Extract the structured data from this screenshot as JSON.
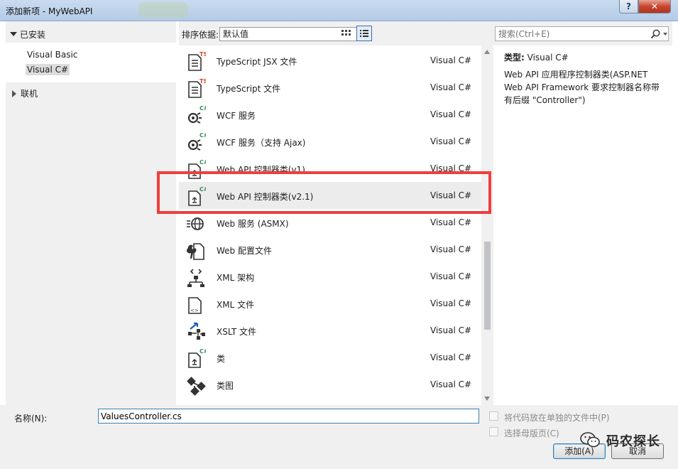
{
  "window": {
    "title": "添加新项 - MyWebAPI",
    "help_label": "?",
    "close_label": "✕"
  },
  "left_tree": {
    "installed": "已安装",
    "children": [
      "Visual Basic",
      "Visual C#"
    ],
    "selected": "Visual C#",
    "online": "联机"
  },
  "toolbar": {
    "sort_label": "排序依据:",
    "sort_value": "默认值"
  },
  "items": [
    {
      "name": "TypeScript JSX 文件",
      "type": "Visual C#",
      "icon": "typescript-file-icon"
    },
    {
      "name": "TypeScript 文件",
      "type": "Visual C#",
      "icon": "typescript-file-icon"
    },
    {
      "name": "WCF 服务",
      "type": "Visual C#",
      "icon": "wcf-service-icon"
    },
    {
      "name": "WCF 服务（支持 Ajax)",
      "type": "Visual C#",
      "icon": "wcf-service-icon"
    },
    {
      "name": "Web API 控制器类(v1)",
      "type": "Visual C#",
      "icon": "csharp-class-icon"
    },
    {
      "name": "Web API 控制器类(v2.1)",
      "type": "Visual C#",
      "icon": "csharp-class-icon"
    },
    {
      "name": "Web 服务 (ASMX)",
      "type": "Visual C#",
      "icon": "web-service-globe-icon"
    },
    {
      "name": "Web 配置文件",
      "type": "Visual C#",
      "icon": "web-config-wrench-icon"
    },
    {
      "name": "XML 架构",
      "type": "Visual C#",
      "icon": "xml-schema-icon"
    },
    {
      "name": "XML 文件",
      "type": "Visual C#",
      "icon": "xml-file-icon"
    },
    {
      "name": "XSLT 文件",
      "type": "Visual C#",
      "icon": "xslt-file-icon"
    },
    {
      "name": "类",
      "type": "Visual C#",
      "icon": "csharp-class-icon"
    },
    {
      "name": "类图",
      "type": "Visual C#",
      "icon": "class-diagram-icon"
    }
  ],
  "selected_item_index": 5,
  "search": {
    "placeholder": "搜索(Ctrl+E)"
  },
  "details": {
    "type_label": "类型:",
    "type_value": "Visual C#",
    "description": "Web API 应用程序控制器类(ASP.NET Web API Framework 要求控制器名称带有后缀 \"Controller\")"
  },
  "bottom": {
    "name_label": "名称(N):",
    "name_value": "ValuesController.cs",
    "checkbox1_label": "将代码放在单独的文件中(P)",
    "checkbox2_label": "选择母版页(C)",
    "add_label": "添加(A)",
    "cancel_label": "取消",
    "watermark": "码农探长"
  },
  "colors": {
    "highlight": "#ef3e3e",
    "csharp_badge": "#2e8b57",
    "ts_badge": "#d2461e"
  }
}
